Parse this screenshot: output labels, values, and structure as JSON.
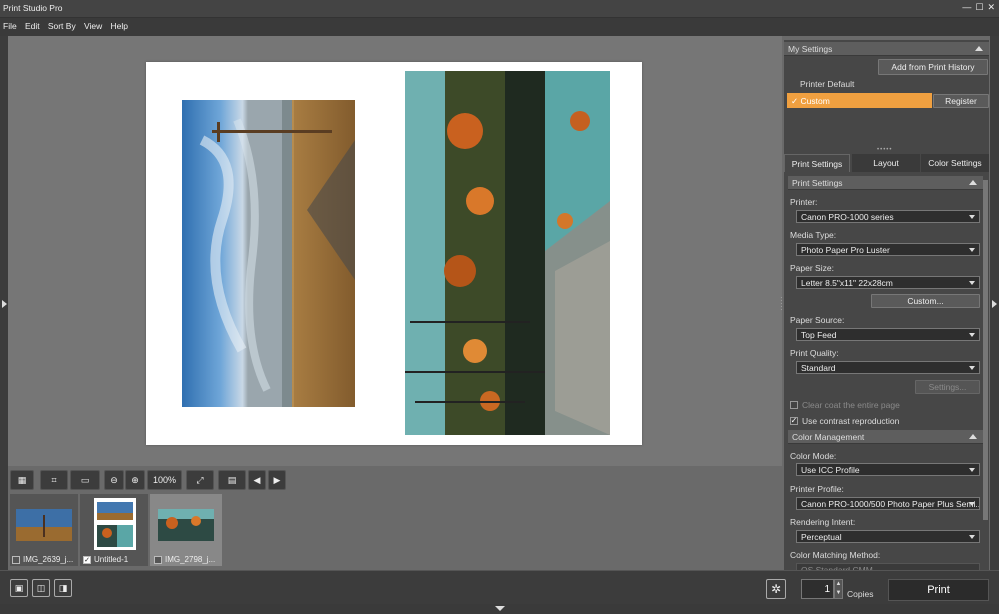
{
  "app": {
    "title": "Print Studio Pro",
    "win_controls": [
      "—",
      "☐",
      "✕"
    ]
  },
  "menu": [
    "File",
    "Edit",
    "Sort By",
    "View",
    "Help"
  ],
  "toolbar": {
    "zoom": "100%"
  },
  "thumbnails": [
    {
      "label": "IMG_2639_j..."
    },
    {
      "label": "Untitled-1"
    },
    {
      "label": "IMG_2798_j..."
    }
  ],
  "bottom": {
    "copies": "1",
    "copies_label": "Copies",
    "print_label": "Print"
  },
  "my_settings": {
    "header": "My Settings",
    "add_history": "Add from Print History",
    "items": [
      "Printer Default",
      "Custom"
    ],
    "register": "Register"
  },
  "tabs": [
    "Print Settings",
    "Layout",
    "Color Settings"
  ],
  "print_settings": {
    "header": "Print Settings",
    "printer_label": "Printer:",
    "printer": "Canon PRO-1000 series",
    "media_label": "Media Type:",
    "media": "Photo Paper Pro Luster",
    "size_label": "Paper Size:",
    "size": "Letter 8.5\"x11\" 22x28cm",
    "custom_btn": "Custom...",
    "source_label": "Paper Source:",
    "source": "Top Feed",
    "quality_label": "Print Quality:",
    "quality": "Standard",
    "settings_btn": "Settings...",
    "clear_coat": "Clear coat the entire page",
    "contrast": "Use contrast reproduction"
  },
  "color_mgmt": {
    "header": "Color Management",
    "mode_label": "Color Mode:",
    "mode": "Use ICC Profile",
    "profile_label": "Printer Profile:",
    "profile": "Canon PRO-1000/500 Photo Paper Plus Semi...",
    "intent_label": "Rendering Intent:",
    "intent": "Perceptual",
    "match_label": "Color Matching Method:",
    "match": "OS Standard CMM"
  },
  "colors": {
    "accent": "#f0a040",
    "print_btn": "#2b2b2b"
  }
}
